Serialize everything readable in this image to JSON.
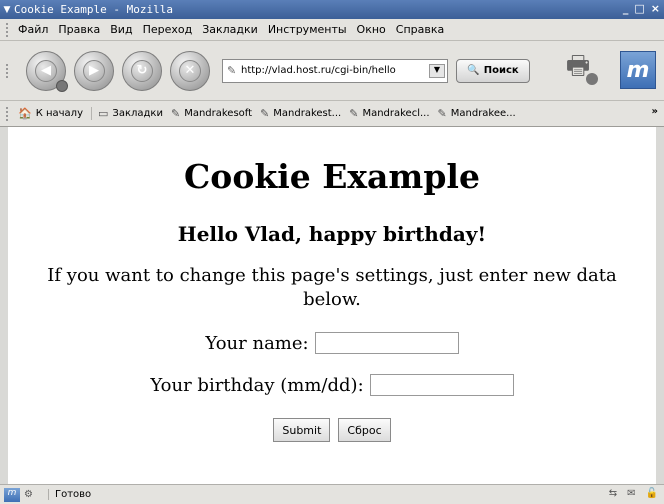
{
  "window": {
    "title": "Cookie Example - Mozilla"
  },
  "menubar": {
    "items": [
      {
        "label": "Файл",
        "u": "Ф"
      },
      {
        "label": "Правка",
        "u": "П"
      },
      {
        "label": "Вид",
        "u": "В"
      },
      {
        "label": "Переход",
        "u": "П"
      },
      {
        "label": "Закладки",
        "u": "З"
      },
      {
        "label": "Инструменты",
        "u": "И"
      },
      {
        "label": "Окно",
        "u": "О"
      },
      {
        "label": "Справка",
        "u": "С"
      }
    ]
  },
  "navbar": {
    "url": "http://vlad.host.ru/cgi-bin/hello",
    "search_label": "Поиск"
  },
  "bookmarks": {
    "home_label": "К началу",
    "folder_label": "Закладки",
    "items": [
      "Mandrakesoft",
      "Mandrakest...",
      "Mandrakecl...",
      "Mandrakee..."
    ],
    "more": "»"
  },
  "page": {
    "heading": "Cookie Example",
    "greeting": "Hello Vlad, happy birthday!",
    "intro": "If you want to change this page's settings, just enter new data below.",
    "name_label": "Your name:",
    "name_value": "",
    "birthday_label": "Your birthday (mm/dd):",
    "birthday_value": "",
    "submit_label": "Submit",
    "reset_label": "Сброс"
  },
  "status": {
    "text": "Готово"
  }
}
